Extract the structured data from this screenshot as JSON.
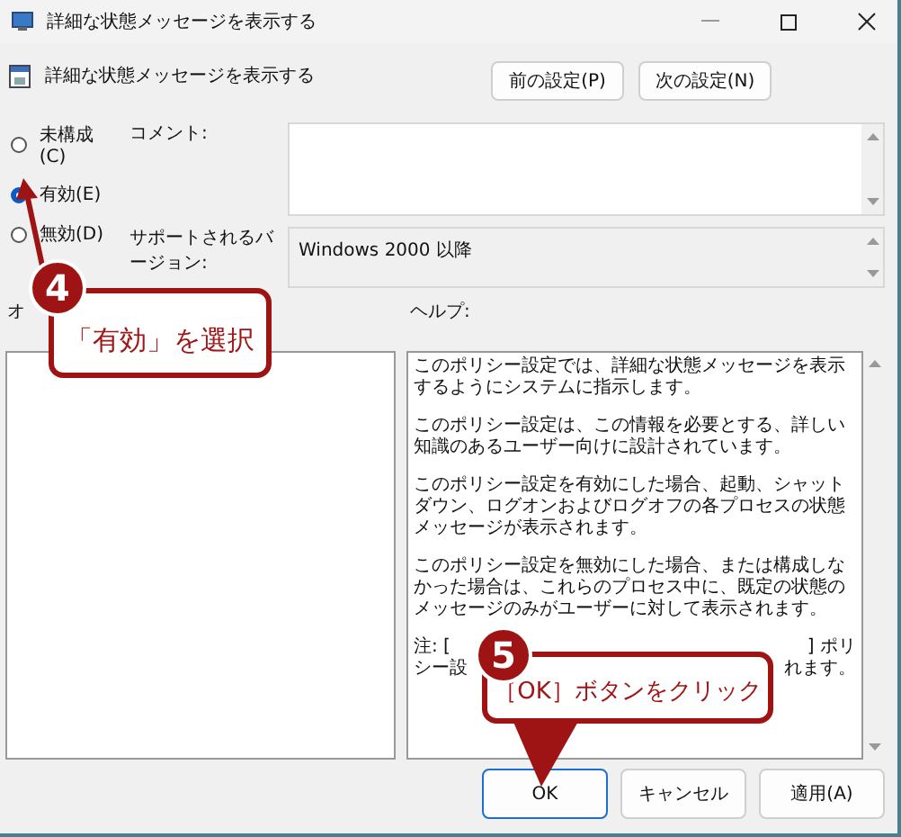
{
  "window": {
    "title": "詳細な状態メッセージを表示する"
  },
  "header": {
    "title": "詳細な状態メッセージを表示する"
  },
  "nav_buttons": [
    "前の設定(P)",
    "次の設定(N)"
  ],
  "radios": [
    {
      "label": "未構成(C)",
      "selected": false
    },
    {
      "label": "有効(E)",
      "selected": true
    },
    {
      "label": "無効(D)",
      "selected": false
    }
  ],
  "comment": {
    "label": "コメント:"
  },
  "supported": {
    "label": "サポートされるバージョン:",
    "value": "Windows 2000 以降"
  },
  "options": {
    "label": "オ"
  },
  "help": {
    "label": "ヘルプ:",
    "paragraphs": [
      "このポリシー設定では、詳細な状態メッセージを表示するようにシステムに指示します。",
      "このポリシー設定は、この情報を必要とする、詳しい知識のあるユーザー向けに設計されています。",
      "このポリシー設定を有効にした場合、起動、シャットダウン、ログオンおよびログオフの各プロセスの状態メッセージが表示されます。",
      "このポリシー設定を無効にした場合、または構成しなかった場合は、これらのプロセス中に、既定の状態のメッセージのみがユーザーに対して表示されます。"
    ],
    "note_lines": [
      [
        "注: [",
        "] ポリ"
      ],
      [
        "シー設",
        "れます。"
      ]
    ]
  },
  "buttons": [
    {
      "label": "OK",
      "default": true
    },
    {
      "label": "キャンセル",
      "default": false
    },
    {
      "label": "適用(A)",
      "default": false
    }
  ],
  "callouts": [
    {
      "number": "4",
      "text": "「有効」を選択"
    },
    {
      "number": "5",
      "text": "［OK］ボタンをクリック"
    }
  ]
}
